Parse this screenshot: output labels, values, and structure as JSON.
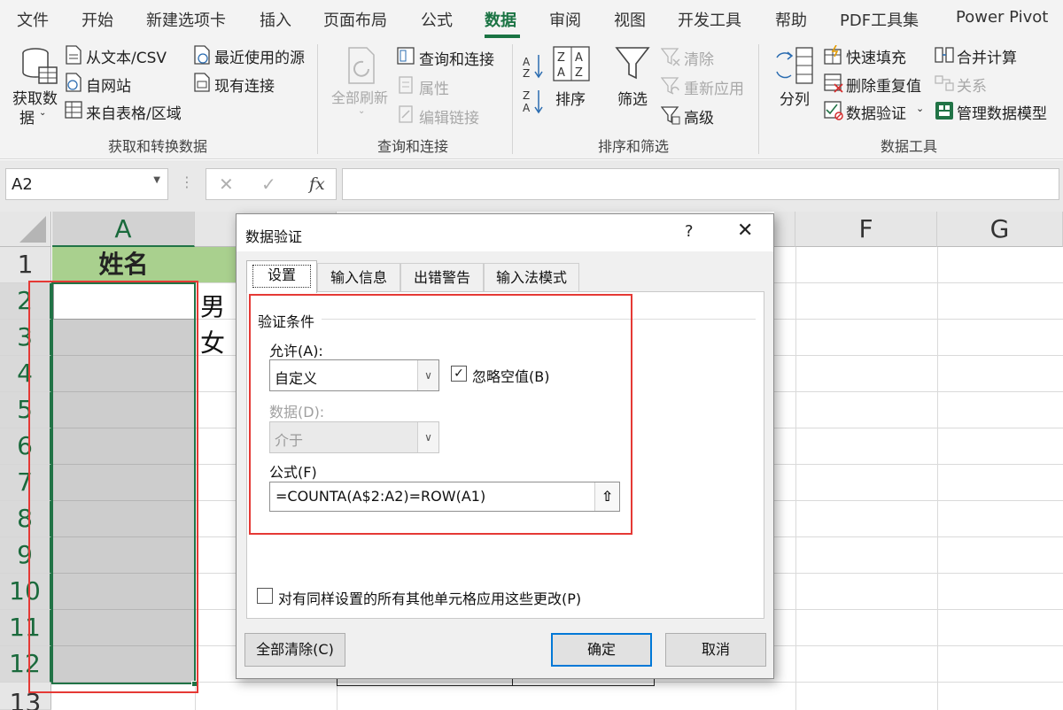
{
  "menu": {
    "tabs": [
      "文件",
      "开始",
      "新建选项卡",
      "插入",
      "页面布局",
      "公式",
      "数据",
      "审阅",
      "视图",
      "开发工具",
      "帮助",
      "PDF工具集",
      "Power Pivot"
    ],
    "active_tab": "数据"
  },
  "ribbon": {
    "get_transform": {
      "get_data_line1": "获取数",
      "get_data_line2": "据",
      "from_text_csv": "从文本/CSV",
      "from_web": "自网站",
      "from_table": "来自表格/区域",
      "recent_sources": "最近使用的源",
      "existing_connections": "现有连接",
      "group_label": "获取和转换数据"
    },
    "queries": {
      "refresh_all": "全部刷新",
      "queries_connections": "查询和连接",
      "properties": "属性",
      "edit_links": "编辑链接",
      "group_label": "查询和连接"
    },
    "sort_filter": {
      "sort": "排序",
      "filter": "筛选",
      "clear": "清除",
      "reapply": "重新应用",
      "advanced": "高级",
      "group_label": "排序和筛选"
    },
    "data_tools": {
      "text_to_columns": "分列",
      "flash_fill": "快速填充",
      "remove_duplicates": "删除重复值",
      "data_validation": "数据验证",
      "consolidate": "合并计算",
      "relationships": "关系",
      "manage_data_model": "管理数据模型",
      "group_label": "数据工具"
    }
  },
  "formula_bar": {
    "name_box": "A2",
    "fx": "fx",
    "cancel_glyph": "✕",
    "enter_glyph": "✓",
    "value": ""
  },
  "sheet": {
    "columns": [
      "A",
      "F",
      "G"
    ],
    "rows": [
      "1",
      "2",
      "3",
      "4",
      "5",
      "6",
      "7",
      "8",
      "9",
      "10",
      "11",
      "12",
      "13"
    ],
    "cells": {
      "A1": "姓名",
      "B2": "男",
      "B3": "女"
    }
  },
  "dialog": {
    "title": "数据验证",
    "help": "?",
    "close": "✕",
    "tabs": [
      "设置",
      "输入信息",
      "出错警告",
      "输入法模式"
    ],
    "active_tab": "设置",
    "section_title": "验证条件",
    "allow_label": "允许(A):",
    "allow_value": "自定义",
    "ignore_blank_label": "忽略空值(B)",
    "ignore_blank_checked": true,
    "data_label": "数据(D):",
    "data_value": "介于",
    "formula_label": "公式(F)",
    "formula_value": "=COUNTA(A$2:A2)=ROW(A1)",
    "apply_all_label": "对有同样设置的所有其他单元格应用这些更改(P)",
    "apply_all_checked": false,
    "clear_all": "全部清除(C)",
    "ok": "确定",
    "cancel": "取消"
  },
  "colors": {
    "accent_green": "#217346",
    "header_fill": "#a9d08e",
    "selection_fill": "#cdcdcd",
    "annotation_red": "#e53935",
    "ok_border": "#0078d7"
  }
}
